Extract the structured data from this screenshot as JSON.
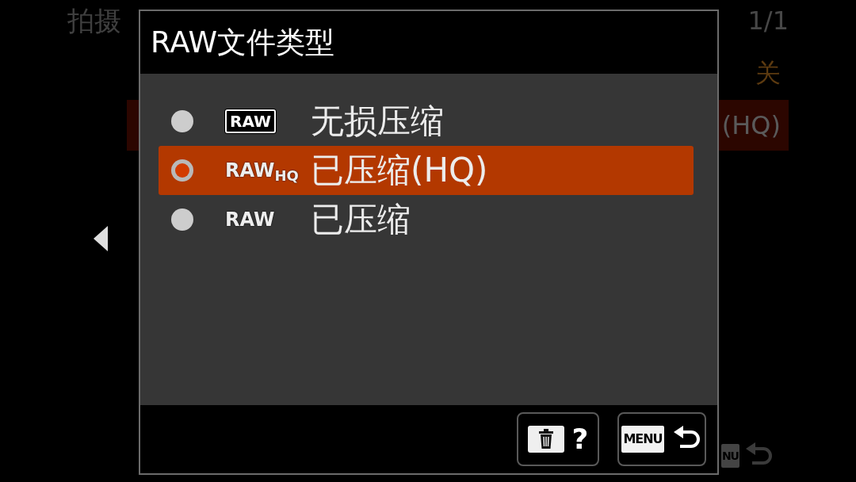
{
  "background_menu": {
    "breadcrumb": "拍摄",
    "page": "1/1",
    "rows": [
      {
        "value": "关",
        "selected": false
      },
      {
        "value": "(HQ)",
        "selected": true
      }
    ],
    "footer_key": "NU"
  },
  "dialog": {
    "title": "RAW文件类型",
    "options": [
      {
        "badge": {
          "kind": "boxed",
          "text": "RAW"
        },
        "label": "无损压缩",
        "selected": false
      },
      {
        "badge": {
          "kind": "plain",
          "text": "RAW$_{HQ}$"
        },
        "label": "已压缩(HQ)",
        "selected": true
      },
      {
        "badge": {
          "kind": "plain",
          "text": "RAW"
        },
        "label": "已压缩",
        "selected": false
      }
    ],
    "buttons": [
      {
        "kind": "help",
        "label": "?"
      },
      {
        "kind": "back",
        "label": "MENU"
      }
    ]
  }
}
